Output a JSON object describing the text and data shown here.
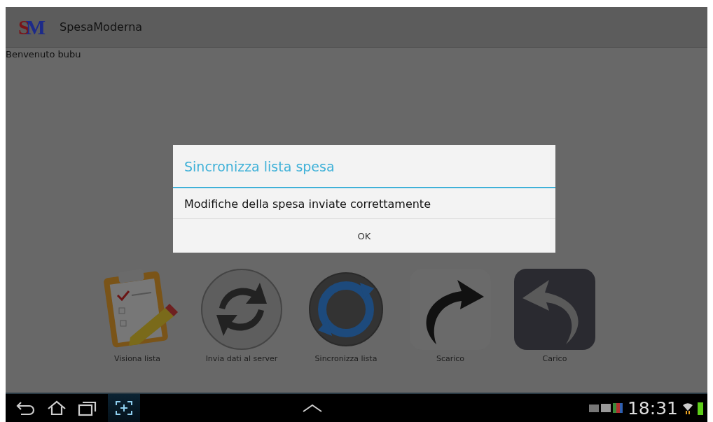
{
  "action_bar": {
    "logo": [
      {
        "char": "S",
        "color": "#7a1418"
      },
      {
        "char": "M",
        "color": "#1c2a8a"
      }
    ],
    "title": "SpesaModerna"
  },
  "welcome": "Benvenuto bubu",
  "launcher": [
    {
      "kind": "clipboard",
      "label": "Visiona lista"
    },
    {
      "kind": "arrows",
      "label": "Invia dati al server"
    },
    {
      "kind": "sync",
      "label": "Sincronizza lista"
    },
    {
      "kind": "forward",
      "label": "Scarico"
    },
    {
      "kind": "back",
      "label": "Carico"
    }
  ],
  "dialog": {
    "title": "Sincronizza lista spesa",
    "message": "Modifiche della spesa inviate correttamente",
    "buttons": [
      "OK"
    ]
  },
  "nav_bar": {
    "time": "18:31"
  }
}
